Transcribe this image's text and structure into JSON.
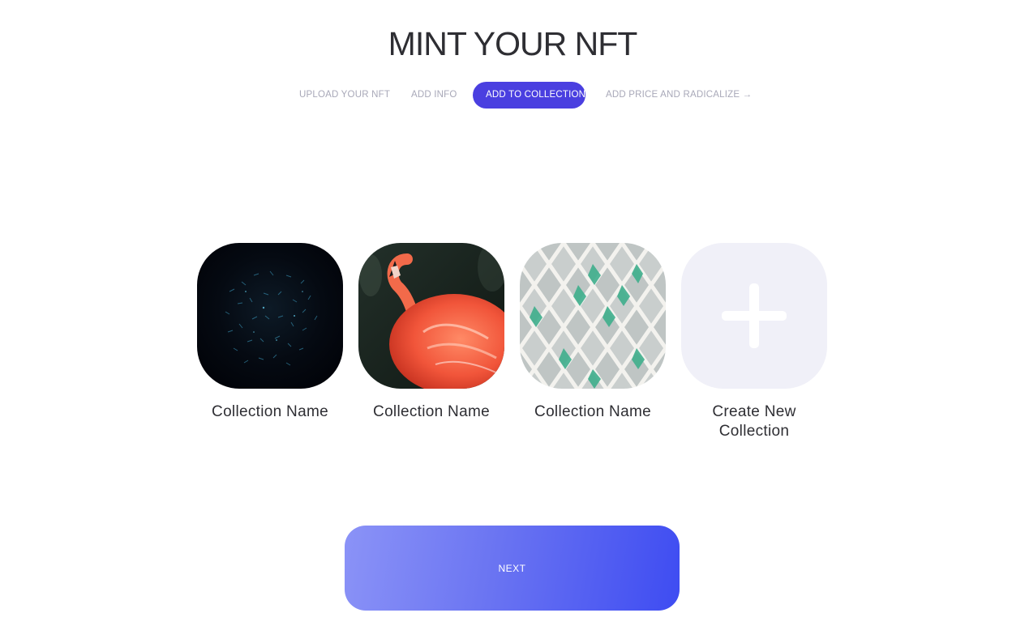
{
  "header": {
    "title": "MINT YOUR NFT"
  },
  "steps": [
    {
      "label": "UPLOAD YOUR NFT",
      "active": false
    },
    {
      "label": "ADD INFO",
      "active": false
    },
    {
      "label": "ADD TO COLLECTION",
      "active": true
    },
    {
      "label": "ADD PRICE AND RADICALIZE →",
      "active": false
    }
  ],
  "collections": [
    {
      "name": "Collection Name",
      "thumbnail": "dark-particle-artwork"
    },
    {
      "name": "Collection Name",
      "thumbnail": "flamingo-photo"
    },
    {
      "name": "Collection Name",
      "thumbnail": "diamond-lattice-facade"
    }
  ],
  "create_new": {
    "label": "Create New Collection",
    "icon": "plus-icon"
  },
  "footer": {
    "next_label": "NEXT"
  },
  "colors": {
    "accent": "#4a3fe0",
    "step_inactive": "#a8a8b8",
    "new_collection_bg": "#f0f0f8",
    "next_gradient_start": "#8b93f7",
    "next_gradient_end": "#3e4cf2"
  }
}
